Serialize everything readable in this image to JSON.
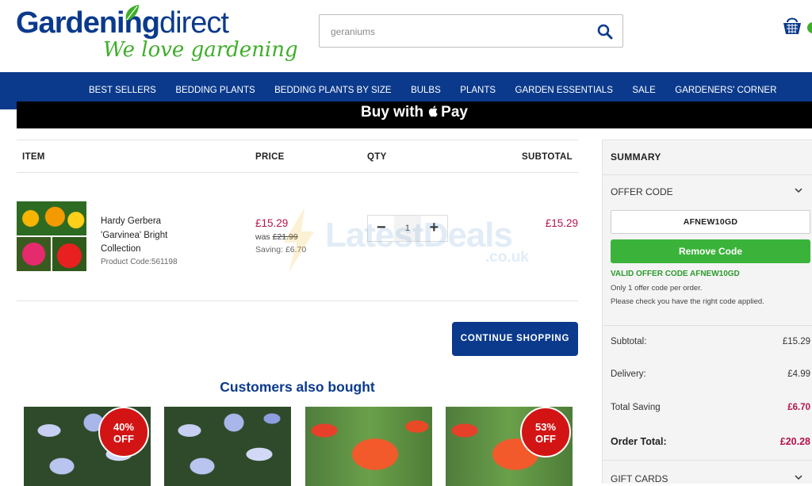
{
  "brand": {
    "name_part1": "Gardening",
    "name_part2": "direct",
    "tagline": "We love gardening"
  },
  "search": {
    "value": "geraniums"
  },
  "nav": {
    "items": [
      "BEST SELLERS",
      "BEDDING PLANTS",
      "BEDDING PLANTS BY SIZE",
      "BULBS",
      "PLANTS",
      "GARDEN ESSENTIALS",
      "SALE",
      "GARDENERS' CORNER"
    ]
  },
  "apple_pay": {
    "prefix": "Buy with",
    "suffix": "Pay"
  },
  "cart": {
    "headers": {
      "item": "ITEM",
      "price": "PRICE",
      "qty": "QTY",
      "subtotal": "SUBTOTAL"
    },
    "items": [
      {
        "name": "Hardy Gerbera 'Garvinea' Bright Collection",
        "code": "Product Code:561198",
        "price": "£15.29",
        "was_label": "was",
        "was_price": "£21.99",
        "saving": "Saving: £6.70",
        "qty": "1",
        "subtotal": "£15.29"
      }
    ],
    "continue_label": "CONTINUE SHOPPING"
  },
  "watermark": {
    "text": "LatestDeals",
    "sub": ".co.uk"
  },
  "also_bought": {
    "title": "Customers also bought",
    "badges": [
      "40%",
      "OFF",
      "53%",
      "OFF"
    ]
  },
  "summary": {
    "title": "SUMMARY",
    "offer_label": "OFFER CODE",
    "offer_code": "AFNEW10GD",
    "remove_label": "Remove Code",
    "valid_text": "VALID OFFER CODE AFNEW10GD",
    "note1": "Only 1 offer code per order.",
    "note2": "Please check you have the right code applied.",
    "subtotal_label": "Subtotal:",
    "subtotal_value": "£15.29",
    "delivery_label": "Delivery:",
    "delivery_value": "£4.99",
    "saving_label": "Total Saving",
    "saving_value": "£6.70",
    "total_label": "Order Total:",
    "total_value": "£20.28",
    "gift_label": "GIFT CARDS"
  },
  "colors": {
    "brand_blue": "#0b3a8c",
    "brand_green": "#3fae2a",
    "price_pink": "#b3134e",
    "remove_green": "#3bb33b",
    "badge_red": "#d31414"
  }
}
